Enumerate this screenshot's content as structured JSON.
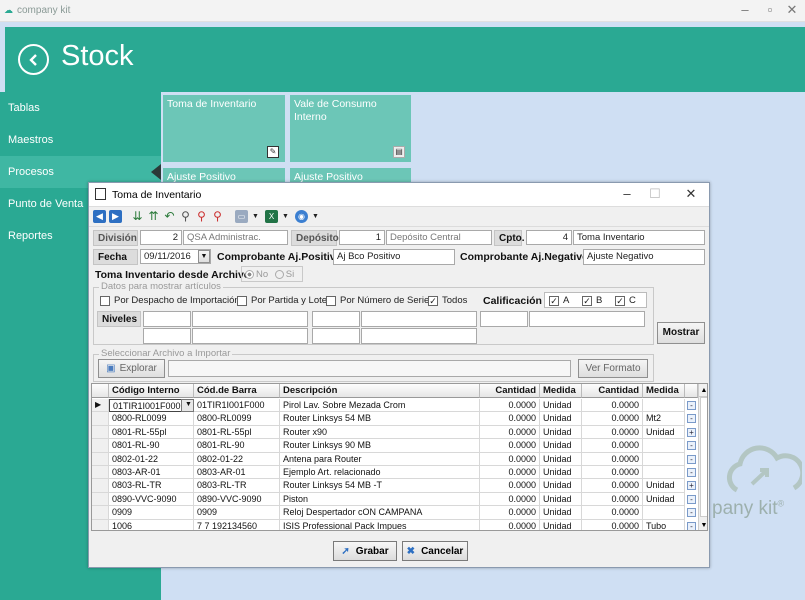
{
  "app": {
    "name": "company kit",
    "icon": "company-kit-logo"
  },
  "page": {
    "title": "Stock"
  },
  "sidebar": {
    "items": [
      {
        "label": "Tablas"
      },
      {
        "label": "Maestros"
      },
      {
        "label": "Procesos"
      },
      {
        "label": "Punto de Venta"
      },
      {
        "label": "Reportes"
      }
    ]
  },
  "tiles": [
    {
      "label": "Toma de Inventario"
    },
    {
      "label": "Vale de Consumo Interno"
    },
    {
      "label": "Ajuste Positivo"
    },
    {
      "label": "Ajuste Positivo"
    }
  ],
  "watermark": "pany kit",
  "watermark_reg": "®",
  "dialog": {
    "title": "Toma de Inventario",
    "division_label": "División",
    "division_code": "2",
    "division_name": "QSA Administrac.",
    "deposito_label": "Depósito",
    "deposito_code": "1",
    "deposito_name": "Depósito Central",
    "cpto_label": "Cpto.",
    "cpto_code": "4",
    "cpto_name": "Toma Inventario",
    "fecha_label": "Fecha",
    "fecha_value": "09/11/2016",
    "comp_pos_label": "Comprobante Aj.Positivo",
    "comp_pos_value": "Aj Bco  Positivo",
    "comp_neg_label": "Comprobante Aj.Negativo",
    "comp_neg_value": "Ajuste Negativo",
    "desde_archivo_label": "Toma Inventario desde Archivo",
    "radio_no": "No",
    "radio_si": "Si",
    "datos_group": "Datos para mostrar artículos",
    "check_despacho": "Por Despacho de Importación",
    "check_partida": "Por Partida y Lote",
    "check_serie": "Por Número de Serie",
    "check_todos": "Todos",
    "check_mark": "✓",
    "calificacion_label": "Calificación",
    "cal_a": "A",
    "cal_b": "B",
    "cal_c": "C",
    "niveles_label": "Niveles",
    "mostrar_btn": "Mostrar",
    "archivo_group": "Seleccionar Archivo a Importar",
    "explorar_btn": "Explorar",
    "ver_formato_btn": "Ver Formato",
    "grabar_btn": "Grabar",
    "cancelar_btn": "Cancelar"
  },
  "grid": {
    "columns": [
      "Código Interno",
      "Cód.de Barra",
      "Descripción",
      "Cantidad",
      "Medida",
      "Cantidad",
      "Medida"
    ],
    "rows": [
      {
        "codigo": "01TIR1I001F000",
        "barra": "01TIR1I001F000",
        "desc": "Pirol Lav. Sobre Mezada Crom",
        "cant": "0.0000",
        "med": "Unidad",
        "cant2": "0.0000",
        "med2": "",
        "pm": "-"
      },
      {
        "codigo": "0800-RL0099",
        "barra": "0800-RL0099",
        "desc": "Router Linksys 54 MB",
        "cant": "0.0000",
        "med": "Unidad",
        "cant2": "0.0000",
        "med2": "Mt2",
        "pm": "-"
      },
      {
        "codigo": "0801-RL-55pl",
        "barra": "0801-RL-55pl",
        "desc": "Router x90",
        "cant": "0.0000",
        "med": "Unidad",
        "cant2": "0.0000",
        "med2": "Unidad",
        "pm": "+"
      },
      {
        "codigo": "0801-RL-90",
        "barra": "0801-RL-90",
        "desc": "Router Linksys 90 MB",
        "cant": "0.0000",
        "med": "Unidad",
        "cant2": "0.0000",
        "med2": "",
        "pm": "-"
      },
      {
        "codigo": "0802-01-22",
        "barra": "0802-01-22",
        "desc": "Antena para Router",
        "cant": "0.0000",
        "med": "Unidad",
        "cant2": "0.0000",
        "med2": "",
        "pm": "-"
      },
      {
        "codigo": "0803-AR-01",
        "barra": "0803-AR-01",
        "desc": "Ejemplo Art. relacionado",
        "cant": "0.0000",
        "med": "Unidad",
        "cant2": "0.0000",
        "med2": "",
        "pm": "-"
      },
      {
        "codigo": "0803-RL-TR",
        "barra": "0803-RL-TR",
        "desc": "Router Linksys 54 MB  -T",
        "cant": "0.0000",
        "med": "Unidad",
        "cant2": "0.0000",
        "med2": "Unidad",
        "pm": "+"
      },
      {
        "codigo": "0890-VVC-9090",
        "barra": "0890-VVC-9090",
        "desc": "Piston",
        "cant": "0.0000",
        "med": "Unidad",
        "cant2": "0.0000",
        "med2": "Unidad",
        "pm": "-"
      },
      {
        "codigo": "0909",
        "barra": "0909",
        "desc": "Reloj Despertador cON CAMPANA",
        "cant": "0.0000",
        "med": "Unidad",
        "cant2": "0.0000",
        "med2": "",
        "pm": "-"
      },
      {
        "codigo": "1006",
        "barra": "7 7 192134560",
        "desc": "ISIS Professional Pack Impues",
        "cant": "0.0000",
        "med": "Unidad",
        "cant2": "0.0000",
        "med2": "Tubo",
        "pm": "-"
      }
    ]
  }
}
